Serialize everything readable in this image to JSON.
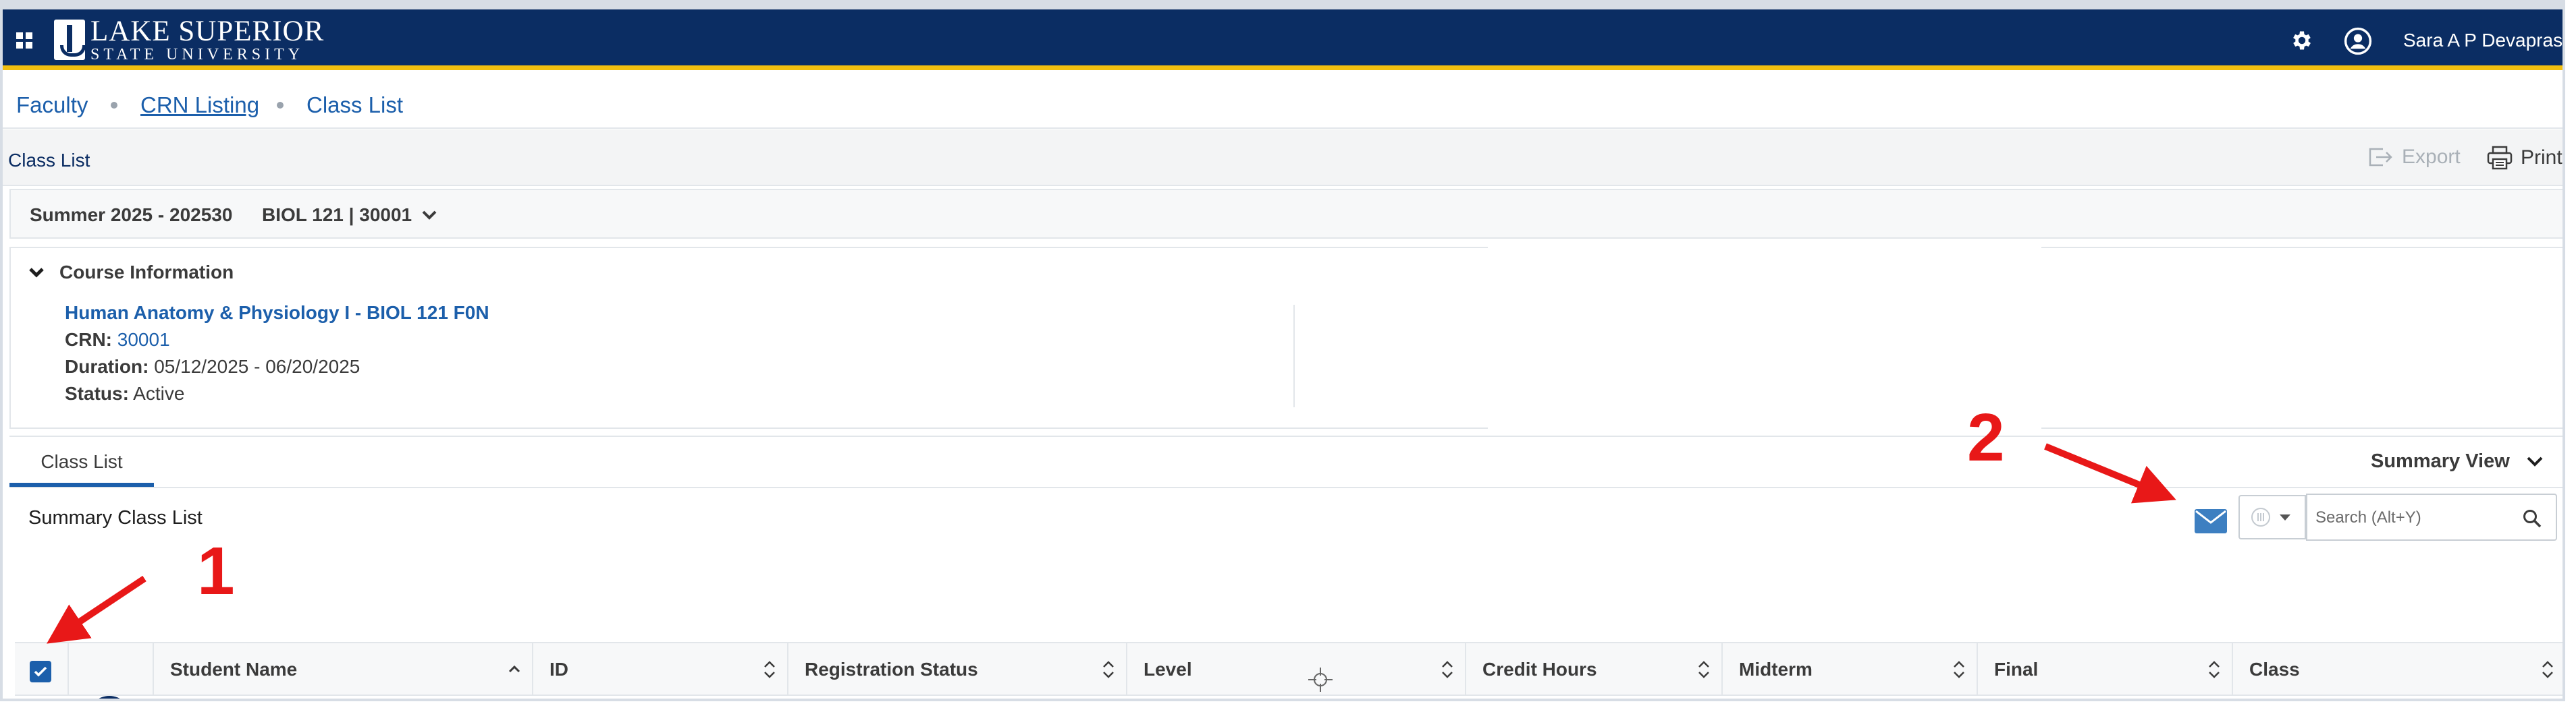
{
  "header": {
    "logo_line1": "LAKE SUPERIOR",
    "logo_line2": "STATE UNIVERSITY",
    "user_name": "Sara A P Devaprasad",
    "brand_color": "#0b2d63",
    "accent_color": "#f2bf0f"
  },
  "breadcrumb": {
    "items": [
      "Faculty",
      "CRN Listing",
      "Class List"
    ]
  },
  "page": {
    "title": "Class List",
    "export_label": "Export",
    "print_label": "Print"
  },
  "term_bar": {
    "term": "Summer 2025 - 202530",
    "course": "BIOL 121 | 30001"
  },
  "course_info": {
    "heading": "Course Information",
    "course_title": "Human Anatomy & Physiology I - BIOL 121 F0N",
    "crn_label": "CRN:",
    "crn_value": "30001",
    "duration_label": "Duration:",
    "duration_value": "05/12/2025 - 06/20/2025",
    "status_label": "Status:",
    "status_value": "Active"
  },
  "tabs": {
    "active": "Class List",
    "view_selector": "Summary View"
  },
  "list": {
    "title": "Summary Class List",
    "search_placeholder": "Search (Alt+Y)",
    "select_all_checked": true,
    "columns": [
      "Student Name",
      "ID",
      "Registration Status",
      "Level",
      "Credit Hours",
      "Midterm",
      "Final",
      "Class"
    ]
  },
  "annotations": {
    "one": "1",
    "two": "2",
    "color": "#e81818"
  },
  "icons": [
    "apps-grid-icon",
    "gear-icon",
    "user-circle-icon",
    "export-icon",
    "printer-icon",
    "chevron-down-icon",
    "mail-icon",
    "columns-icon",
    "search-icon",
    "checkmark-icon",
    "sort-icon"
  ]
}
